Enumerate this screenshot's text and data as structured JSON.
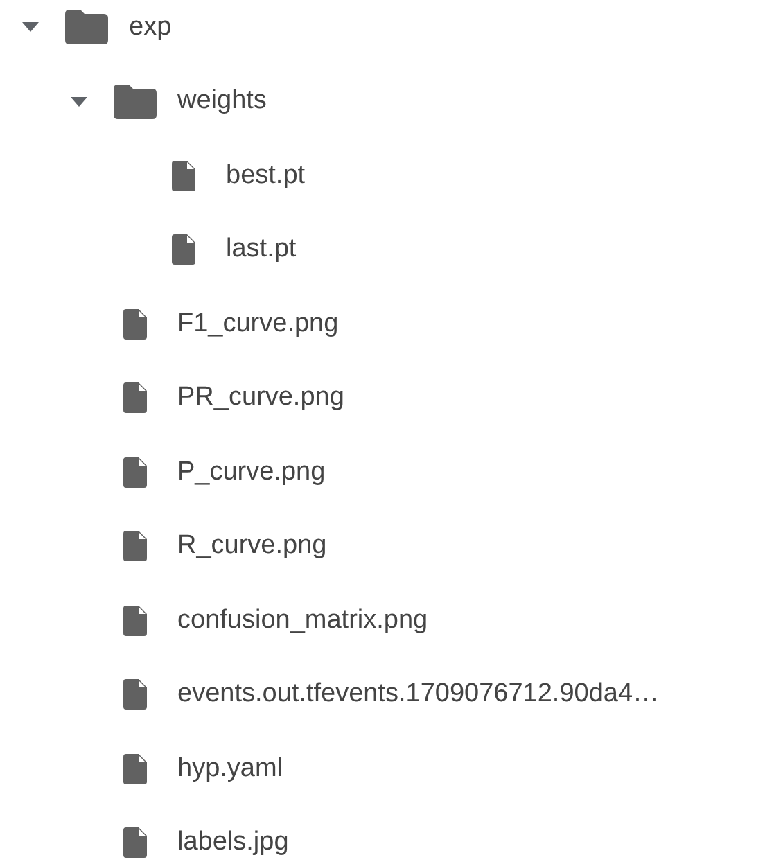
{
  "tree": [
    {
      "kind": "folder",
      "name": "exp",
      "expanded": true,
      "children": [
        {
          "kind": "folder",
          "name": "weights",
          "expanded": true,
          "children": [
            {
              "kind": "file",
              "name": "best.pt"
            },
            {
              "kind": "file",
              "name": "last.pt"
            }
          ]
        },
        {
          "kind": "file",
          "name": "F1_curve.png"
        },
        {
          "kind": "file",
          "name": "PR_curve.png"
        },
        {
          "kind": "file",
          "name": "P_curve.png"
        },
        {
          "kind": "file",
          "name": "R_curve.png"
        },
        {
          "kind": "file",
          "name": "confusion_matrix.png"
        },
        {
          "kind": "file",
          "name": "events.out.tfevents.1709076712.90da4…"
        },
        {
          "kind": "file",
          "name": "hyp.yaml"
        },
        {
          "kind": "file",
          "name": "labels.jpg"
        }
      ]
    }
  ]
}
